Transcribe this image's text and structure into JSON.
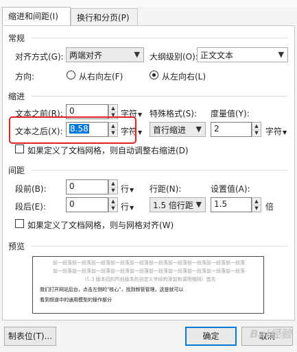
{
  "tabs": [
    {
      "label": "缩进和间距(I)"
    },
    {
      "label": "换行和分页(P)"
    }
  ],
  "general": {
    "section_label": "常规",
    "alignment_label": "对齐方式(G):",
    "alignment_value": "两端对齐",
    "outline_label": "大纲级别(O):",
    "outline_value": "正文文本",
    "direction_label": "方向:",
    "rtl_label": "从右向左(F)",
    "ltr_label": "从左向右(L)"
  },
  "indent": {
    "section_label": "缩进",
    "before_label": "文本之前(R):",
    "before_value": "0",
    "unit_label": "字符",
    "special_label": "特殊格式(S):",
    "measure_label": "度量值(Y):",
    "after_label": "文本之后(X):",
    "after_value": "8.58",
    "special_value": "首行缩进",
    "measure_value": "2",
    "grid_check_label": "如果定义了文档网格，则自动调整右缩进(D)"
  },
  "spacing": {
    "section_label": "间距",
    "before_label": "段前(B):",
    "before_value": "0",
    "after_label": "段后(E):",
    "after_value": "0",
    "unit_label": "行",
    "line_label": "行距(N):",
    "line_value": "1.5 倍行距",
    "setting_label": "设置值(A):",
    "setting_value": "1.5",
    "setting_unit": "倍",
    "grid_check_label": "如果定义了文档网格，则与网格对齐(W)"
  },
  "preview": {
    "section_label": "预览",
    "lines_gray": [
      "前一段落前一段落前一段落前一段落前一段落前一段落前一段落前一段落前一段落前一段落",
      "前一段落前一段落前一段落前一段落前一段落前一段落前一段落前一段落前一段落前一段落",
      "（5.3 版本后的所创版本的自定义字段的添加和调用相同）首先"
    ],
    "lines_dark": [
      "我们打开网站后台，点击左侧的\"核心\"，找到频管管理，这是就可以",
      "看到频道中的通用模型的操作部分"
    ]
  },
  "buttons": {
    "tabs_label": "制表位(T)...",
    "ok_label": "确定",
    "cancel_label": "取消"
  },
  "watermark": "Bai经验"
}
